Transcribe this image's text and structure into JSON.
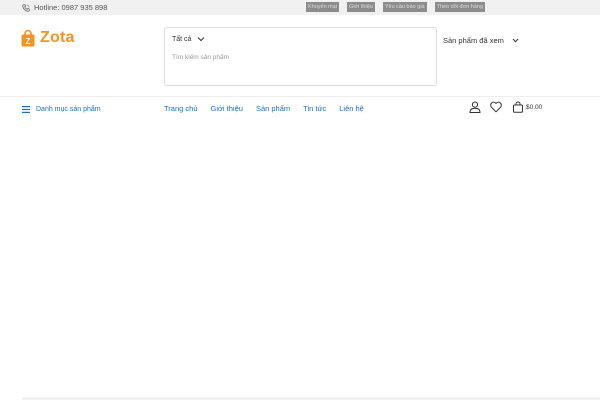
{
  "topbar": {
    "hotline_label": "Hotline: 0987 935 898",
    "links": [
      {
        "label": "Khuyến mại"
      },
      {
        "label": "Giới thiệu"
      },
      {
        "label": "Yêu cầu báo giá"
      },
      {
        "label": "Theo dõi đơn hàng"
      }
    ]
  },
  "brand": {
    "name": "Zota",
    "badge": "Z",
    "color": "#f5931e"
  },
  "search": {
    "category": "Tất cả",
    "placeholder": "Tìm kiếm sản phẩm"
  },
  "viewed": {
    "label": "Sản phẩm đã xem"
  },
  "nav": {
    "category_menu": "Danh mục sản phẩm",
    "items": [
      {
        "label": "Trang chủ"
      },
      {
        "label": "Giới thiệu"
      },
      {
        "label": "Sản phẩm"
      },
      {
        "label": "Tin tức"
      },
      {
        "label": "Liên hệ"
      }
    ],
    "link_color": "#1a6ec1"
  },
  "cart": {
    "total": "$0.00"
  }
}
